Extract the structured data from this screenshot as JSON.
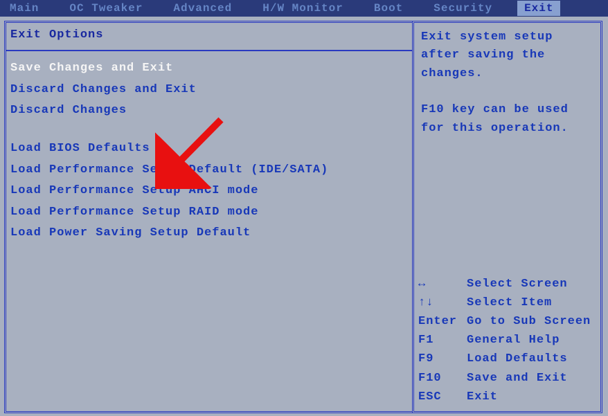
{
  "menubar": {
    "items": [
      "Main",
      "OC Tweaker",
      "Advanced",
      "H/W Monitor",
      "Boot",
      "Security",
      "Exit"
    ],
    "active_index": 6
  },
  "left": {
    "title": "Exit Options",
    "group1": [
      "Save Changes and Exit",
      "Discard Changes and Exit",
      "Discard Changes"
    ],
    "group2": [
      "Load BIOS Defaults",
      "Load Performance Setup Default (IDE/SATA)",
      "Load Performance Setup AHCI mode",
      "Load Performance Setup RAID mode",
      "Load Power Saving Setup Default"
    ],
    "highlighted_index": 0
  },
  "right": {
    "help_lines": [
      "Exit system setup",
      "after saving the",
      "changes.",
      "",
      "F10 key can be used",
      "for this operation."
    ]
  },
  "keys": [
    {
      "key": "↔",
      "desc": "Select Screen"
    },
    {
      "key": "↑↓",
      "desc": "Select Item"
    },
    {
      "key": "Enter",
      "desc": "Go to Sub Screen"
    },
    {
      "key": "F1",
      "desc": "General Help"
    },
    {
      "key": "F9",
      "desc": "Load Defaults"
    },
    {
      "key": "F10",
      "desc": "Save and Exit"
    },
    {
      "key": "ESC",
      "desc": "Exit"
    }
  ]
}
